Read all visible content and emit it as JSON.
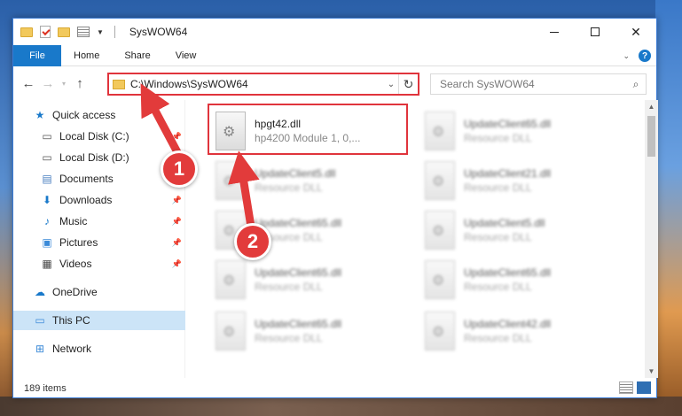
{
  "window": {
    "title": "SysWOW64",
    "controls": {
      "minimize": "",
      "maximize": "",
      "close": "✕"
    }
  },
  "ribbon": {
    "tabs": [
      "File",
      "Home",
      "Share",
      "View"
    ],
    "help": "?"
  },
  "address": {
    "path": "C:\\Windows\\SysWOW64",
    "search_placeholder": "Search SysWOW64"
  },
  "nav": [
    {
      "label": "Quick access",
      "icon": "star-icon"
    },
    {
      "label": "Local Disk (C:)",
      "icon": "drive-icon",
      "pinned": true
    },
    {
      "label": "Local Disk (D:)",
      "icon": "drive-icon"
    },
    {
      "label": "Documents",
      "icon": "documents-icon",
      "pinned": true
    },
    {
      "label": "Downloads",
      "icon": "download-icon",
      "pinned": true
    },
    {
      "label": "Music",
      "icon": "music-icon",
      "pinned": true
    },
    {
      "label": "Pictures",
      "icon": "pictures-icon",
      "pinned": true
    },
    {
      "label": "Videos",
      "icon": "videos-icon",
      "pinned": true
    },
    {
      "label": "OneDrive",
      "icon": "cloud-icon"
    },
    {
      "label": "This PC",
      "icon": "computer-icon",
      "selected": true
    },
    {
      "label": "Network",
      "icon": "network-icon"
    }
  ],
  "files": [
    {
      "name": "hpgt42.dll",
      "desc": "hp4200 Module 1, 0,..."
    },
    {
      "name": "UpdateClient65.dll",
      "desc": "Resource DLL"
    },
    {
      "name": "UpdateClient5.dll",
      "desc": "Resource DLL"
    },
    {
      "name": "UpdateClient21.dll",
      "desc": "Resource DLL"
    },
    {
      "name": "UpdateClient65.dll",
      "desc": "Resource DLL"
    },
    {
      "name": "UpdateClient5.dll",
      "desc": "Resource DLL"
    },
    {
      "name": "UpdateClient65.dll",
      "desc": "Resource DLL"
    },
    {
      "name": "UpdateClient65.dll",
      "desc": "Resource DLL"
    },
    {
      "name": "UpdateClient65.dll",
      "desc": "Resource DLL"
    },
    {
      "name": "UpdateClient42.dll",
      "desc": "Resource DLL"
    }
  ],
  "status": {
    "count": "189 items"
  },
  "annotations": {
    "step1": "1",
    "step2": "2"
  },
  "colors": {
    "accent": "#1979ca",
    "highlight": "#e0343c",
    "selected": "#cce4f7"
  }
}
